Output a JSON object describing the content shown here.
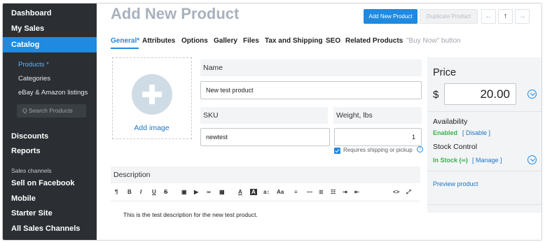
{
  "sidebar": {
    "items": [
      {
        "label": "Dashboard"
      },
      {
        "label": "My Sales"
      },
      {
        "label": "Catalog"
      }
    ],
    "catalog_sub": [
      {
        "label": "Products *"
      },
      {
        "label": "Categories"
      },
      {
        "label": "eBay & Amazon listings"
      }
    ],
    "search_placeholder": "Q  Search Products",
    "lower_items": [
      {
        "label": "Discounts"
      },
      {
        "label": "Reports"
      }
    ],
    "section_label": "Sales channels",
    "channel_items": [
      {
        "label": "Sell on Facebook"
      },
      {
        "label": "Mobile"
      },
      {
        "label": "Starter Site"
      },
      {
        "label": "All Sales Channels"
      }
    ]
  },
  "header": {
    "title": "Add New Product",
    "add_button": "Add New Product",
    "duplicate_button": "Duplicate Product",
    "arrow_left": "←",
    "arrow_up": "↑",
    "arrow_right": "→"
  },
  "tabs": [
    {
      "label": "General*"
    },
    {
      "label": "Attributes"
    },
    {
      "label": "Options"
    },
    {
      "label": "Gallery"
    },
    {
      "label": "Files"
    },
    {
      "label": "Tax and Shipping"
    },
    {
      "label": "SEO"
    },
    {
      "label": "Related Products"
    },
    {
      "label": "\"Buy Now\" button"
    }
  ],
  "form": {
    "add_image": "Add image",
    "name_label": "Name",
    "name_value": "New test product",
    "sku_label": "SKU",
    "sku_value": "newtest",
    "weight_label": "Weight, lbs",
    "weight_value": "1",
    "requires_shipping": "Requires shipping or pickup",
    "description_label": "Description",
    "description_text": "This is the test description for the new test product."
  },
  "toolbar": [
    "¶",
    "B",
    "I",
    "U",
    "S",
    "▣",
    "▶",
    "∞",
    "▦",
    "A",
    "A",
    "a↕",
    "Aa",
    "≡",
    "—",
    "≣",
    "☷",
    "⇥",
    "⇤",
    "<>",
    "⤢"
  ],
  "price_panel": {
    "price_label": "Price",
    "currency": "$",
    "price_value": "20.00",
    "availability_label": "Availability",
    "availability_status": "Enabled",
    "disable_link": "[ Disable ]",
    "stock_label": "Stock Control",
    "stock_status": "In Stock (∞)",
    "manage_link": "[ Manage ]",
    "preview_link": "Preview product"
  },
  "colors": {
    "accent": "#1f8ae0",
    "sidebar_bg": "#2b2f33",
    "success": "#3bb34a"
  }
}
